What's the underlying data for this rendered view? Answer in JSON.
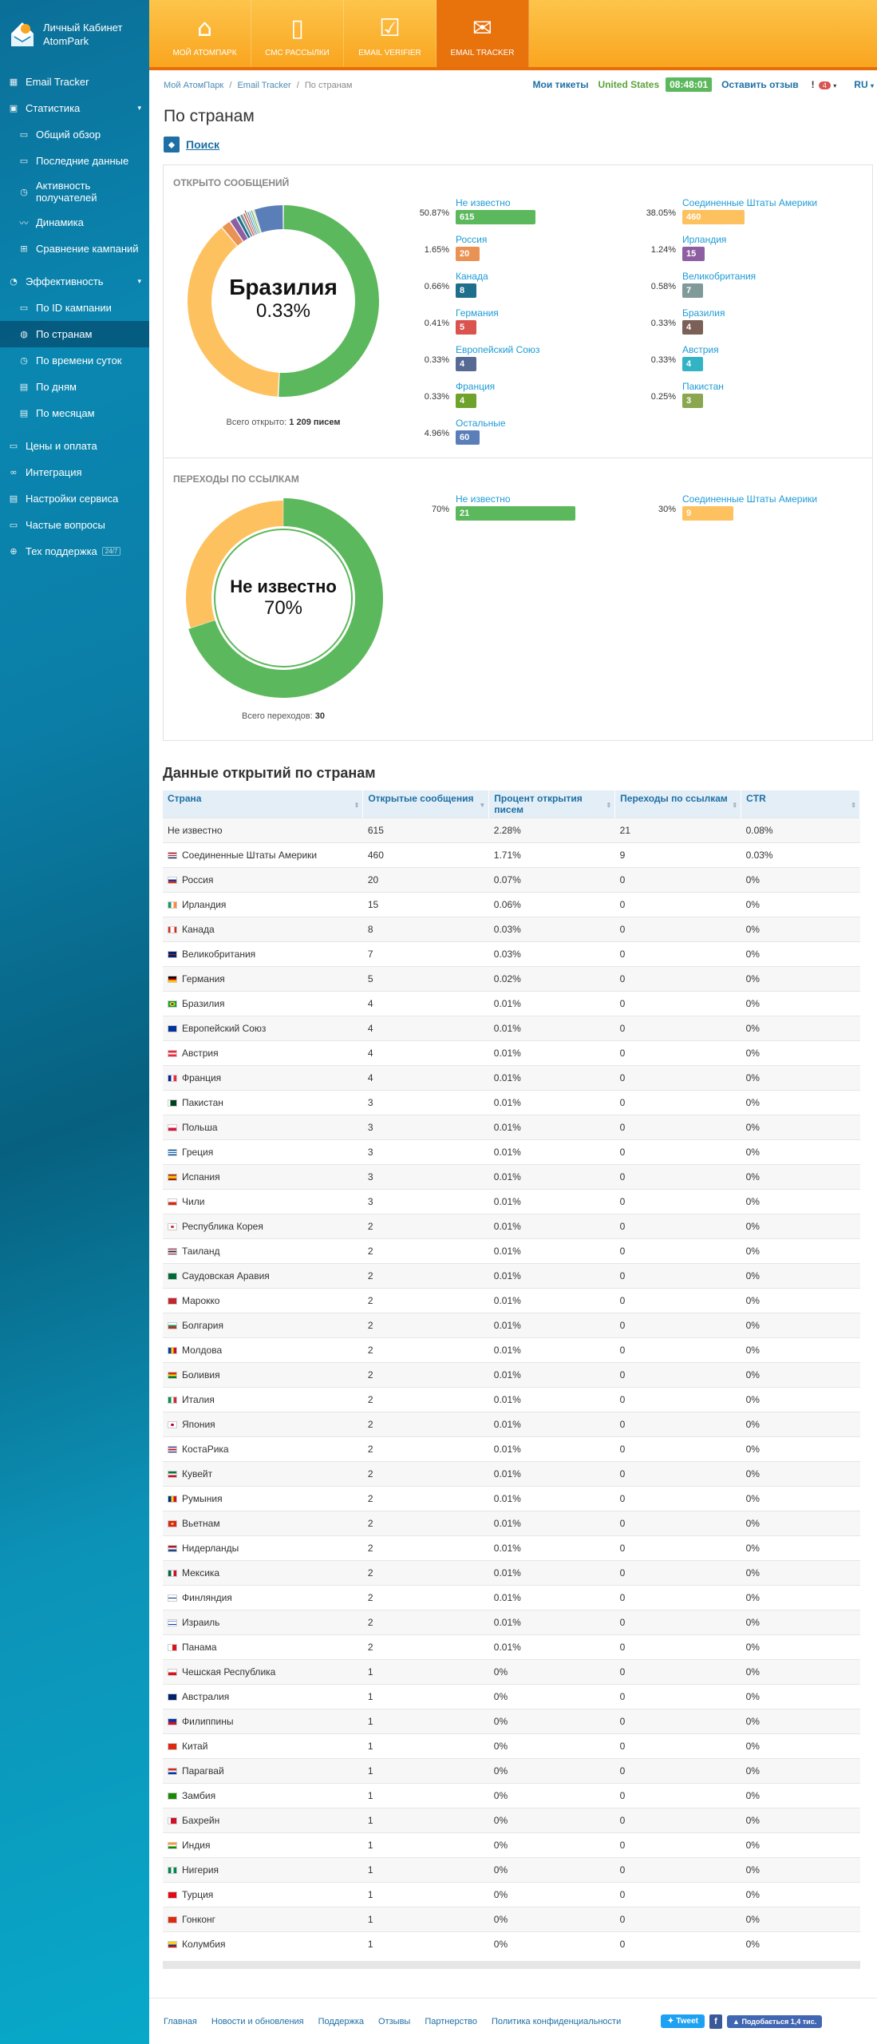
{
  "app": {
    "title_line1": "Личный Кабинет",
    "title_line2": "AtomPark"
  },
  "sidebar": {
    "items": [
      {
        "label": "Email Tracker",
        "icon": "grid-icon",
        "level": 1
      },
      {
        "label": "Статистика",
        "icon": "chart-icon",
        "level": 1,
        "caret": "▾"
      },
      {
        "label": "Общий обзор",
        "icon": "doc-icon",
        "level": 2
      },
      {
        "label": "Последние данные",
        "icon": "doc-icon",
        "level": 2
      },
      {
        "label": "Активность получателей",
        "icon": "clock-icon",
        "level": 2
      },
      {
        "label": "Динамика",
        "icon": "pulse-icon",
        "level": 2
      },
      {
        "label": "Сравнение кампаний",
        "icon": "compare-icon",
        "level": 2
      },
      {
        "label": "Эффективность",
        "icon": "gauge-icon",
        "level": 1,
        "caret": "▾"
      },
      {
        "label": "По ID кампании",
        "icon": "doc-icon",
        "level": 2
      },
      {
        "label": "По странам",
        "icon": "globe-icon",
        "level": 2,
        "active": true
      },
      {
        "label": "По времени суток",
        "icon": "clock-icon",
        "level": 2
      },
      {
        "label": "По дням",
        "icon": "calendar-icon",
        "level": 2
      },
      {
        "label": "По месяцам",
        "icon": "calendar-icon",
        "level": 2
      },
      {
        "label": "Цены и оплата",
        "icon": "wallet-icon",
        "level": 1
      },
      {
        "label": "Интеграция",
        "icon": "link-icon",
        "level": 1
      },
      {
        "label": "Настройки сервиса",
        "icon": "settings-icon",
        "level": 1
      },
      {
        "label": "Частые вопросы",
        "icon": "faq-icon",
        "level": 1
      },
      {
        "label": "Тех поддержка",
        "icon": "lifebuoy-icon",
        "level": 1,
        "badge": "24/7"
      }
    ]
  },
  "topnav": {
    "tabs": [
      {
        "label": "МОЙ АТОМПАРК",
        "icon": "home-icon"
      },
      {
        "label": "СМС РАССЫЛКИ",
        "icon": "phone-icon"
      },
      {
        "label": "EMAIL VERIFIER",
        "icon": "checkbox-icon"
      },
      {
        "label": "EMAIL TRACKER",
        "icon": "tracker-icon",
        "active": true
      }
    ]
  },
  "breadcrumb": {
    "items": [
      "Мой АтомПарк",
      "Email Tracker",
      "По странам"
    ],
    "sep": "/"
  },
  "header_tools": {
    "tickets": "Мои тикеты",
    "country": "United States",
    "time": "08:48:01",
    "feedback": "Оставить отзыв",
    "notif_count": "4",
    "lang": "RU"
  },
  "page": {
    "title": "По странам",
    "search_label": "Поиск"
  },
  "opens": {
    "title": "ОТКРЫТО СООБЩЕНИЙ",
    "center_name": "Бразилия",
    "center_pct": "0.33%",
    "total_label": "Всего открыто:",
    "total_value": "1 209 писем",
    "legend": [
      {
        "name": "Не известно",
        "pct": "50.87%",
        "value": "615",
        "color": "#5cb85c",
        "w": 100
      },
      {
        "name": "Соединенные Штаты Америки",
        "pct": "38.05%",
        "value": "460",
        "color": "#fdc15f",
        "w": 78
      },
      {
        "name": "Россия",
        "pct": "1.65%",
        "value": "20",
        "color": "#e99254",
        "w": 30
      },
      {
        "name": "Ирландия",
        "pct": "1.24%",
        "value": "15",
        "color": "#8e5ea2",
        "w": 28
      },
      {
        "name": "Канада",
        "pct": "0.66%",
        "value": "8",
        "color": "#1f6e8c",
        "w": 26
      },
      {
        "name": "Великобритания",
        "pct": "0.58%",
        "value": "7",
        "color": "#7f9a99",
        "w": 26
      },
      {
        "name": "Германия",
        "pct": "0.41%",
        "value": "5",
        "color": "#d9534f",
        "w": 26
      },
      {
        "name": "Бразилия",
        "pct": "0.33%",
        "value": "4",
        "color": "#7a6056",
        "w": 26
      },
      {
        "name": "Европейский Союз",
        "pct": "0.33%",
        "value": "4",
        "color": "#566a94",
        "w": 26
      },
      {
        "name": "Австрия",
        "pct": "0.33%",
        "value": "4",
        "color": "#32b4c5",
        "w": 26
      },
      {
        "name": "Франция",
        "pct": "0.33%",
        "value": "4",
        "color": "#6fa22a",
        "w": 26
      },
      {
        "name": "Пакистан",
        "pct": "0.25%",
        "value": "3",
        "color": "#8aa64f",
        "w": 26
      },
      {
        "name": "Остальные",
        "pct": "4.96%",
        "value": "60",
        "color": "#5a7fb8",
        "w": 30
      }
    ]
  },
  "clicks": {
    "title": "ПЕРЕХОДЫ ПО ССЫЛКАМ",
    "center_name": "Не известно",
    "center_pct": "70%",
    "total_label": "Всего переходов:",
    "total_value": "30",
    "legend": [
      {
        "name": "Не известно",
        "pct": "70%",
        "value": "21",
        "color": "#5cb85c",
        "w": 150
      },
      {
        "name": "Соединенные Штаты Америки",
        "pct": "30%",
        "value": "9",
        "color": "#fdc15f",
        "w": 64
      }
    ]
  },
  "chart_data": [
    {
      "type": "pie",
      "title": "ОТКРЫТО СООБЩЕНИЙ",
      "categories": [
        "Не известно",
        "Соединенные Штаты Америки",
        "Россия",
        "Ирландия",
        "Канада",
        "Великобритания",
        "Германия",
        "Бразилия",
        "Европейский Союз",
        "Австрия",
        "Франция",
        "Пакистан",
        "Остальные"
      ],
      "values": [
        615,
        460,
        20,
        15,
        8,
        7,
        5,
        4,
        4,
        4,
        4,
        3,
        60
      ],
      "colors": [
        "#5cb85c",
        "#fdc15f",
        "#e99254",
        "#8e5ea2",
        "#1f6e8c",
        "#7f9a99",
        "#d9534f",
        "#7a6056",
        "#566a94",
        "#32b4c5",
        "#6fa22a",
        "#8aa64f",
        "#5a7fb8"
      ],
      "highlight_index": 7
    },
    {
      "type": "pie",
      "title": "ПЕРЕХОДЫ ПО ССЫЛКАМ",
      "categories": [
        "Не известно",
        "Соединенные Штаты Америки"
      ],
      "values": [
        21,
        9
      ],
      "colors": [
        "#5cb85c",
        "#fdc15f"
      ],
      "highlight_index": 0
    }
  ],
  "table": {
    "title": "Данные открытий по странам",
    "columns": [
      "Страна",
      "Открытые сообщения",
      "Процент открытия писем",
      "Переходы по ссылкам",
      "CTR"
    ],
    "rows": [
      {
        "country": "Не известно",
        "opens": "615",
        "pct": "2.28%",
        "clicks": "21",
        "ctr": "0.08%",
        "flag": ""
      },
      {
        "country": "Соединенные Штаты Америки",
        "opens": "460",
        "pct": "1.71%",
        "clicks": "9",
        "ctr": "0.03%",
        "flag": "linear-gradient(#b22234 0 20%,#fff 20% 40%,#b22234 40% 60%,#fff 60% 80%,#3c3b6e 80%)"
      },
      {
        "country": "Россия",
        "opens": "20",
        "pct": "0.07%",
        "clicks": "0",
        "ctr": "0%",
        "flag": "linear-gradient(#fff 0 33%,#0039a6 33% 66%,#d52b1e 66%)"
      },
      {
        "country": "Ирландия",
        "opens": "15",
        "pct": "0.06%",
        "clicks": "0",
        "ctr": "0%",
        "flag": "linear-gradient(90deg,#169b62 0 33%,#fff 33% 66%,#ff883e 66%)"
      },
      {
        "country": "Канада",
        "opens": "8",
        "pct": "0.03%",
        "clicks": "0",
        "ctr": "0%",
        "flag": "linear-gradient(90deg,#d52b1e 0 25%,#fff 25% 75%,#d52b1e 75%)"
      },
      {
        "country": "Великобритания",
        "opens": "7",
        "pct": "0.03%",
        "clicks": "0",
        "ctr": "0%",
        "flag": "linear-gradient(#012169 0 40%,#c8102e 40% 60%,#012169 60%)"
      },
      {
        "country": "Германия",
        "opens": "5",
        "pct": "0.02%",
        "clicks": "0",
        "ctr": "0%",
        "flag": "linear-gradient(#000 0 33%,#dd0000 33% 66%,#ffce00 66%)"
      },
      {
        "country": "Бразилия",
        "opens": "4",
        "pct": "0.01%",
        "clicks": "0",
        "ctr": "0%",
        "flag": "radial-gradient(#002776 0 25%,#ffdf00 25% 50%,#009c3b 50%)"
      },
      {
        "country": "Европейский Союз",
        "opens": "4",
        "pct": "0.01%",
        "clicks": "0",
        "ctr": "0%",
        "flag": "linear-gradient(#003399,#003399)"
      },
      {
        "country": "Австрия",
        "opens": "4",
        "pct": "0.01%",
        "clicks": "0",
        "ctr": "0%",
        "flag": "linear-gradient(#ed2939 0 33%,#fff 33% 66%,#ed2939 66%)"
      },
      {
        "country": "Франция",
        "opens": "4",
        "pct": "0.01%",
        "clicks": "0",
        "ctr": "0%",
        "flag": "linear-gradient(90deg,#002395 0 33%,#fff 33% 66%,#ed2939 66%)"
      },
      {
        "country": "Пакистан",
        "opens": "3",
        "pct": "0.01%",
        "clicks": "0",
        "ctr": "0%",
        "flag": "linear-gradient(90deg,#fff 0 25%,#01411c 25%)"
      },
      {
        "country": "Польша",
        "opens": "3",
        "pct": "0.01%",
        "clicks": "0",
        "ctr": "0%",
        "flag": "linear-gradient(#fff 0 50%,#dc143c 50%)"
      },
      {
        "country": "Греция",
        "opens": "3",
        "pct": "0.01%",
        "clicks": "0",
        "ctr": "0%",
        "flag": "linear-gradient(#0d5eaf 0 20%,#fff 20% 40%,#0d5eaf 40% 60%,#fff 60% 80%,#0d5eaf 80%)"
      },
      {
        "country": "Испания",
        "opens": "3",
        "pct": "0.01%",
        "clicks": "0",
        "ctr": "0%",
        "flag": "linear-gradient(#aa151b 0 25%,#f1bf00 25% 75%,#aa151b 75%)"
      },
      {
        "country": "Чили",
        "opens": "3",
        "pct": "0.01%",
        "clicks": "0",
        "ctr": "0%",
        "flag": "linear-gradient(#fff 0 50%,#d52b1e 50%)"
      },
      {
        "country": "Республика Корея",
        "opens": "2",
        "pct": "0.01%",
        "clicks": "0",
        "ctr": "0%",
        "flag": "radial-gradient(#cd2e3a 0 30%,#fff 30%)"
      },
      {
        "country": "Таиланд",
        "opens": "2",
        "pct": "0.01%",
        "clicks": "0",
        "ctr": "0%",
        "flag": "linear-gradient(#a51931 0 17%,#fff 17% 33%,#2d2a4a 33% 67%,#fff 67% 83%,#a51931 83%)"
      },
      {
        "country": "Саудовская Аравия",
        "opens": "2",
        "pct": "0.01%",
        "clicks": "0",
        "ctr": "0%",
        "flag": "linear-gradient(#006c35,#006c35)"
      },
      {
        "country": "Марокко",
        "opens": "2",
        "pct": "0.01%",
        "clicks": "0",
        "ctr": "0%",
        "flag": "linear-gradient(#c1272d,#c1272d)"
      },
      {
        "country": "Болгария",
        "opens": "2",
        "pct": "0.01%",
        "clicks": "0",
        "ctr": "0%",
        "flag": "linear-gradient(#fff 0 33%,#00966e 33% 66%,#d62612 66%)"
      },
      {
        "country": "Молдова",
        "opens": "2",
        "pct": "0.01%",
        "clicks": "0",
        "ctr": "0%",
        "flag": "linear-gradient(90deg,#003da5 0 33%,#ffd200 33% 66%,#cc092f 66%)"
      },
      {
        "country": "Боливия",
        "opens": "2",
        "pct": "0.01%",
        "clicks": "0",
        "ctr": "0%",
        "flag": "linear-gradient(#d52b1e 0 33%,#f9e300 33% 66%,#007934 66%)"
      },
      {
        "country": "Италия",
        "opens": "2",
        "pct": "0.01%",
        "clicks": "0",
        "ctr": "0%",
        "flag": "linear-gradient(90deg,#009246 0 33%,#fff 33% 66%,#ce2b37 66%)"
      },
      {
        "country": "Япония",
        "opens": "2",
        "pct": "0.01%",
        "clicks": "0",
        "ctr": "0%",
        "flag": "radial-gradient(#bc002d 0 30%,#fff 30%)"
      },
      {
        "country": "КостаРика",
        "opens": "2",
        "pct": "0.01%",
        "clicks": "0",
        "ctr": "0%",
        "flag": "linear-gradient(#002b7f 0 17%,#fff 17% 33%,#ce1126 33% 67%,#fff 67% 83%,#002b7f 83%)"
      },
      {
        "country": "Кувейт",
        "opens": "2",
        "pct": "0.01%",
        "clicks": "0",
        "ctr": "0%",
        "flag": "linear-gradient(#007a3d 0 33%,#fff 33% 66%,#ce1126 66%)"
      },
      {
        "country": "Румыния",
        "opens": "2",
        "pct": "0.01%",
        "clicks": "0",
        "ctr": "0%",
        "flag": "linear-gradient(90deg,#002b7f 0 33%,#fcd116 33% 66%,#ce1126 66%)"
      },
      {
        "country": "Вьетнам",
        "opens": "2",
        "pct": "0.01%",
        "clicks": "0",
        "ctr": "0%",
        "flag": "radial-gradient(#ffff00 0 25%,#da251d 25%)"
      },
      {
        "country": "Нидерланды",
        "opens": "2",
        "pct": "0.01%",
        "clicks": "0",
        "ctr": "0%",
        "flag": "linear-gradient(#ae1c28 0 33%,#fff 33% 66%,#21468b 66%)"
      },
      {
        "country": "Мексика",
        "opens": "2",
        "pct": "0.01%",
        "clicks": "0",
        "ctr": "0%",
        "flag": "linear-gradient(90deg,#006847 0 33%,#fff 33% 66%,#ce1126 66%)"
      },
      {
        "country": "Финляндия",
        "opens": "2",
        "pct": "0.01%",
        "clicks": "0",
        "ctr": "0%",
        "flag": "linear-gradient(#fff 0 40%,#003580 40% 60%,#fff 60%)"
      },
      {
        "country": "Израиль",
        "opens": "2",
        "pct": "0.01%",
        "clicks": "0",
        "ctr": "0%",
        "flag": "linear-gradient(#fff 0 15%,#0038b8 15% 25%,#fff 25% 75%,#0038b8 75% 85%,#fff 85%)"
      },
      {
        "country": "Панама",
        "opens": "2",
        "pct": "0.01%",
        "clicks": "0",
        "ctr": "0%",
        "flag": "linear-gradient(90deg,#fff 0 50%,#da121a 50%)"
      },
      {
        "country": "Чешская Республика",
        "opens": "1",
        "pct": "0%",
        "clicks": "0",
        "ctr": "0%",
        "flag": "linear-gradient(#fff 0 50%,#d7141a 50%)"
      },
      {
        "country": "Австралия",
        "opens": "1",
        "pct": "0%",
        "clicks": "0",
        "ctr": "0%",
        "flag": "linear-gradient(#012169,#012169)"
      },
      {
        "country": "Филиппины",
        "opens": "1",
        "pct": "0%",
        "clicks": "0",
        "ctr": "0%",
        "flag": "linear-gradient(#0038a8 0 50%,#ce1126 50%)"
      },
      {
        "country": "Китай",
        "opens": "1",
        "pct": "0%",
        "clicks": "0",
        "ctr": "0%",
        "flag": "linear-gradient(#de2910,#de2910)"
      },
      {
        "country": "Парагвай",
        "opens": "1",
        "pct": "0%",
        "clicks": "0",
        "ctr": "0%",
        "flag": "linear-gradient(#d52b1e 0 33%,#fff 33% 66%,#0038a8 66%)"
      },
      {
        "country": "Замбия",
        "opens": "1",
        "pct": "0%",
        "clicks": "0",
        "ctr": "0%",
        "flag": "linear-gradient(#198a00,#198a00)"
      },
      {
        "country": "Бахрейн",
        "opens": "1",
        "pct": "0%",
        "clicks": "0",
        "ctr": "0%",
        "flag": "linear-gradient(90deg,#fff 0 30%,#ce1126 30%)"
      },
      {
        "country": "Индия",
        "opens": "1",
        "pct": "0%",
        "clicks": "0",
        "ctr": "0%",
        "flag": "linear-gradient(#ff9933 0 33%,#fff 33% 66%,#138808 66%)"
      },
      {
        "country": "Нигерия",
        "opens": "1",
        "pct": "0%",
        "clicks": "0",
        "ctr": "0%",
        "flag": "linear-gradient(90deg,#008751 0 33%,#fff 33% 66%,#008751 66%)"
      },
      {
        "country": "Турция",
        "opens": "1",
        "pct": "0%",
        "clicks": "0",
        "ctr": "0%",
        "flag": "linear-gradient(#e30a17,#e30a17)"
      },
      {
        "country": "Гонконг",
        "opens": "1",
        "pct": "0%",
        "clicks": "0",
        "ctr": "0%",
        "flag": "linear-gradient(#de2910,#de2910)"
      },
      {
        "country": "Колумбия",
        "opens": "1",
        "pct": "0%",
        "clicks": "0",
        "ctr": "0%",
        "flag": "linear-gradient(#fcd116 0 50%,#003893 50% 75%,#ce1126 75%)"
      }
    ]
  },
  "footer": {
    "links": [
      "Главная",
      "Новости и обновления",
      "Поддержка",
      "Отзывы",
      "Партнерство",
      "Политика конфиденциальности"
    ],
    "tweet": "Tweet",
    "fb": "f",
    "like": "Подобається 1,4 тис."
  }
}
